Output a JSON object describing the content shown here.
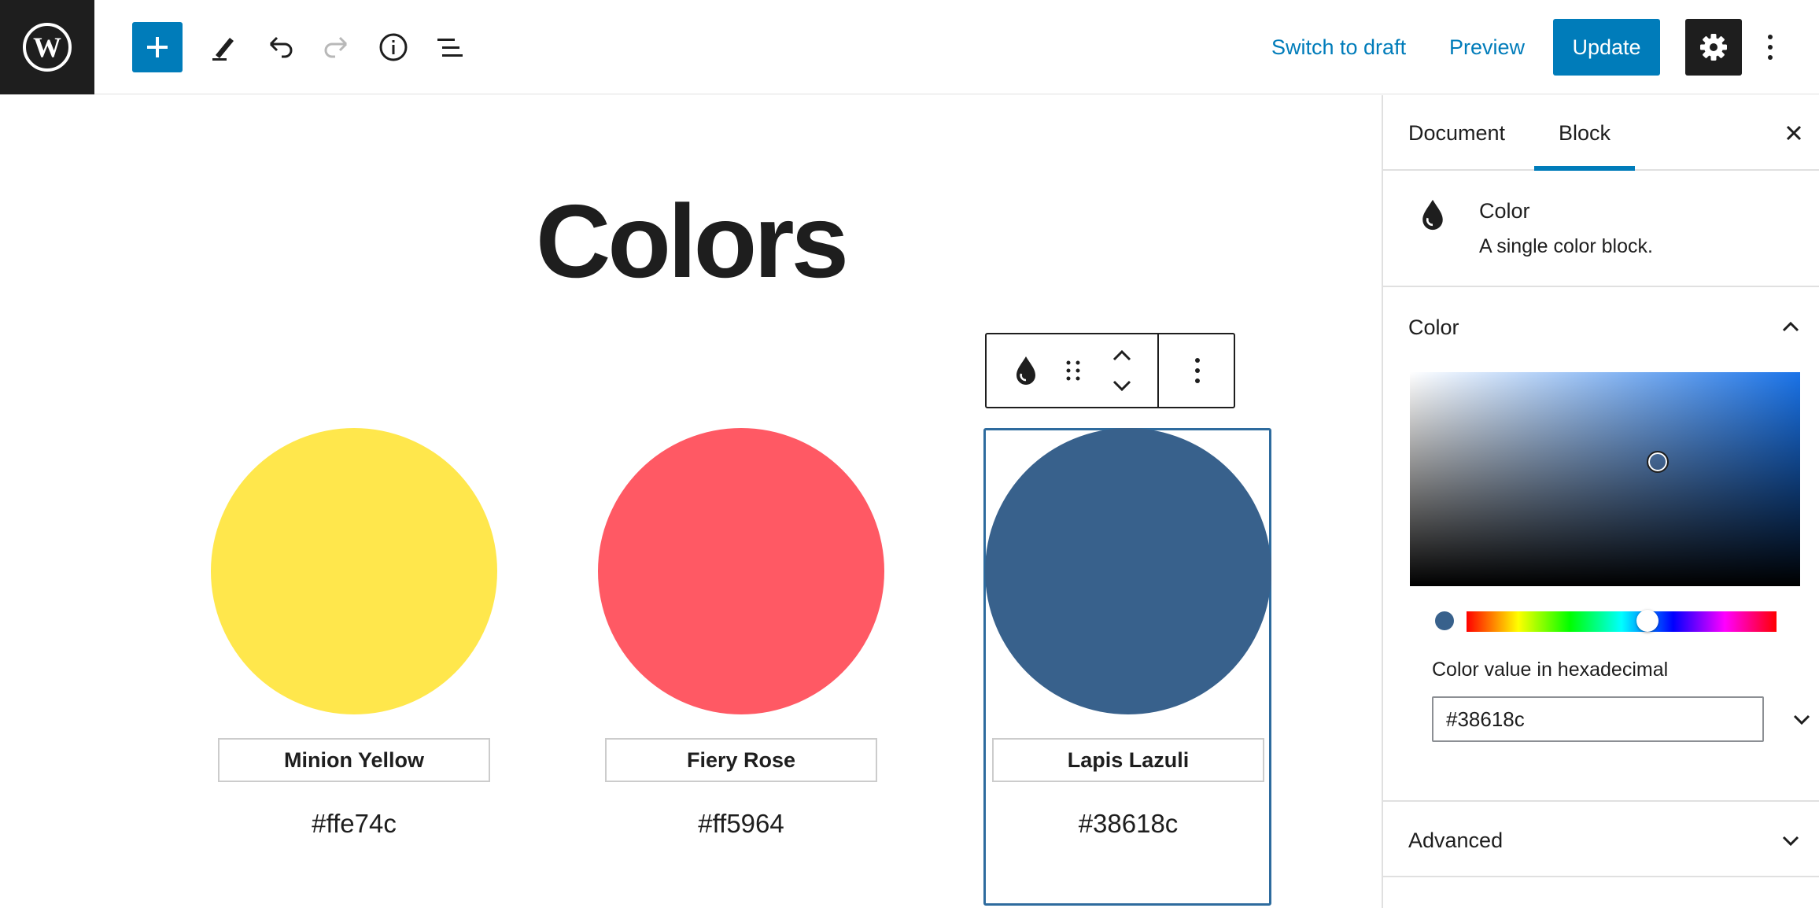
{
  "toolbar": {
    "switch_draft": "Switch to draft",
    "preview": "Preview",
    "update": "Update",
    "icons": [
      "wordpress-logo",
      "plus-icon",
      "pencil-icon",
      "undo-icon",
      "redo-icon",
      "info-icon",
      "list-view-icon",
      "gear-icon",
      "kebab-icon"
    ]
  },
  "page": {
    "title": "Colors"
  },
  "swatches": [
    {
      "name": "Minion Yellow",
      "hex": "#ffe74c",
      "color": "#ffe74c"
    },
    {
      "name": "Fiery Rose",
      "hex": "#ff5964",
      "color": "#ff5964"
    },
    {
      "name": "Lapis Lazuli",
      "hex": "#38618c",
      "color": "#38618c"
    }
  ],
  "sidebar": {
    "tabs": [
      "Document",
      "Block"
    ],
    "active_tab": "Block",
    "block_name": "Color",
    "block_desc": "A single color block.",
    "color_panel": "Color",
    "hex_label": "Color value in hexadecimal",
    "hex_value": "#38618c",
    "advanced_panel": "Advanced"
  },
  "colors": {
    "accent": "#007cba",
    "dark": "#1e1e1e",
    "selected_border": "#2e6b9e"
  }
}
